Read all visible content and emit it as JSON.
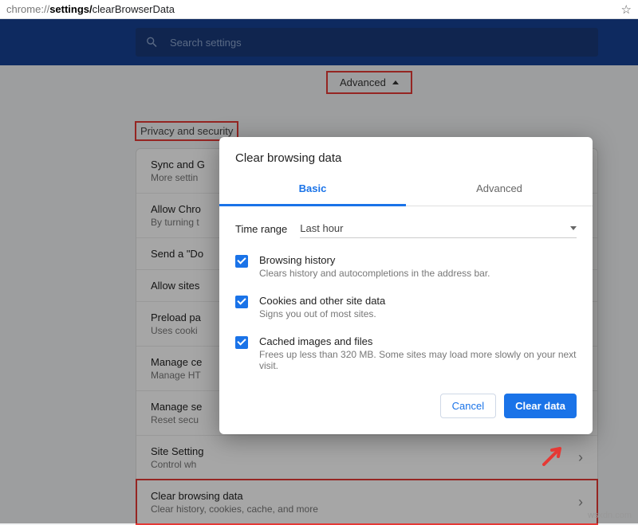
{
  "omnibox": {
    "prefix": "chrome://",
    "mid": "settings/",
    "suffix": "clearBrowserData"
  },
  "search": {
    "placeholder": "Search settings"
  },
  "tabs": {
    "advanced": "Advanced"
  },
  "section": {
    "title": "Privacy and security"
  },
  "rows": {
    "r0": {
      "title": "Sync and G",
      "sub": "More settin"
    },
    "r1": {
      "title": "Allow Chro",
      "sub": "By turning t"
    },
    "r2": {
      "title": "Send a \"Do"
    },
    "r3": {
      "title": "Allow sites"
    },
    "r4": {
      "title": "Preload pa",
      "sub": "Uses cooki"
    },
    "r5": {
      "title": "Manage ce",
      "sub": "Manage HT"
    },
    "r6": {
      "title": "Manage se",
      "sub": "Reset secu"
    },
    "r7": {
      "title": "Site Setting",
      "sub": "Control wh"
    },
    "r8": {
      "title": "Clear browsing data",
      "sub": "Clear history, cookies, cache, and more"
    }
  },
  "dialog": {
    "title": "Clear browsing data",
    "tab_basic": "Basic",
    "tab_advanced": "Advanced",
    "time_label": "Time range",
    "time_value": "Last hour",
    "o1": {
      "t": "Browsing history",
      "d": "Clears history and autocompletions in the address bar."
    },
    "o2": {
      "t": "Cookies and other site data",
      "d": "Signs you out of most sites."
    },
    "o3": {
      "t": "Cached images and files",
      "d": "Frees up less than 320 MB. Some sites may load more slowly on your next visit."
    },
    "cancel": "Cancel",
    "clear": "Clear data"
  },
  "watermark": "wsxdn.com"
}
